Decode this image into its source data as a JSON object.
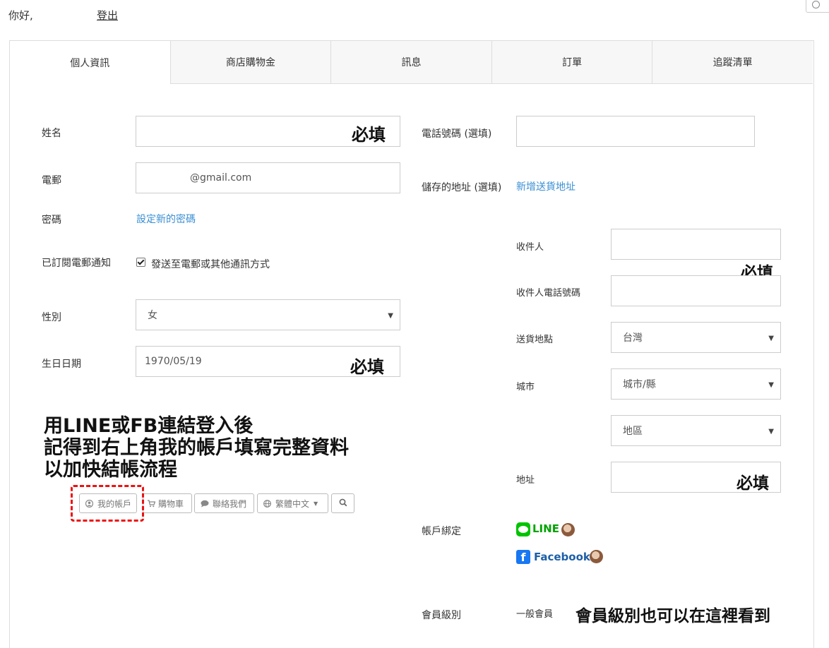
{
  "header": {
    "greeting": "你好,",
    "logout_label": "登出"
  },
  "tabs": [
    {
      "label": "個人資訊",
      "active": true
    },
    {
      "label": "商店購物金",
      "active": false
    },
    {
      "label": "訊息",
      "active": false
    },
    {
      "label": "訂單",
      "active": false
    },
    {
      "label": "追蹤清單",
      "active": false
    }
  ],
  "profile": {
    "name_label": "姓名",
    "name_value": "",
    "email_label": "電郵",
    "email_value": "@gmail.com",
    "password_label": "密碼",
    "password_link": "設定新的密碼",
    "subscribe_label": "已訂閱電郵通知",
    "subscribe_option": "發送至電郵或其他通訊方式",
    "subscribe_checked": true,
    "gender_label": "性別",
    "gender_value": "女",
    "birthday_label": "生日日期",
    "birthday_value": "1970/05/19"
  },
  "contact": {
    "phone_label": "電話號碼 (選填)",
    "phone_value": "",
    "address_label": "儲存的地址 (選填)",
    "add_address_link": "新增送貨地址",
    "recipient_label": "收件人",
    "recipient_phone_label": "收件人電話號碼",
    "delivery_location_label": "送貨地點",
    "delivery_location_value": "台灣",
    "city_label": "城市",
    "city_value": "城市/縣",
    "district_value": "地區",
    "address_field_label": "地址",
    "binding_label": "帳戶綁定",
    "line_label": "LINE",
    "facebook_label": "Facebook",
    "member_level_label": "會員級別",
    "member_level_value": "一般會員"
  },
  "annotations": {
    "required": "必填",
    "login_tip_line1": "用LINE或FB連結登入後",
    "login_tip_line2": "記得到右上角我的帳戶填寫完整資料",
    "login_tip_line3": "以加快結帳流程",
    "member_level_tip": "會員級別也可以在這裡看到"
  },
  "navbar_example": {
    "my_account": "我的帳戶",
    "cart": "購物車",
    "contact_us": "聯絡我們",
    "language": "繁體中文"
  },
  "icons": [
    "user-icon",
    "cart-icon",
    "chat-icon",
    "globe-icon",
    "search-icon",
    "caret-down-icon",
    "line-icon",
    "facebook-icon"
  ],
  "colors": {
    "link": "#3a8fd3",
    "annotation_red": "#ee1111",
    "line_green": "#00c300",
    "facebook_blue": "#1877f2"
  }
}
